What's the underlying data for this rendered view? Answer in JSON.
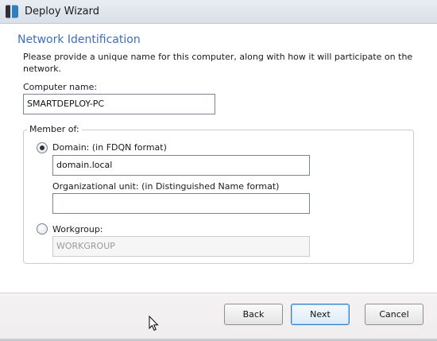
{
  "window": {
    "title": "Deploy Wizard",
    "icon": "app-logo-icon"
  },
  "page": {
    "heading": "Network Identification",
    "description": "Please provide a unique name for this computer, along with how it will participate on the network."
  },
  "computer_name": {
    "label": "Computer name:",
    "value": "SMARTDEPLOY-PC"
  },
  "membership": {
    "legend": "Member of:",
    "selected": "domain",
    "domain": {
      "label": "Domain: (in FDQN format)",
      "value": "domain.local"
    },
    "ou": {
      "label": "Organizational unit: (in Distinguished Name format)",
      "value": ""
    },
    "workgroup": {
      "label": "Workgroup:",
      "value": "WORKGROUP",
      "disabled": true
    }
  },
  "buttons": {
    "back": "Back",
    "next": "Next",
    "cancel": "Cancel"
  },
  "colors": {
    "heading": "#3c6ebf",
    "default_button_border": "#3b7bbf"
  }
}
